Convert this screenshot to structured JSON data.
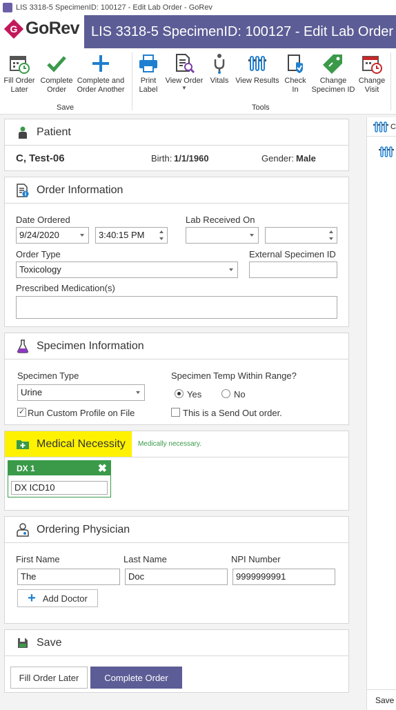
{
  "window": {
    "title": "LIS 3318-5 SpecimenID: 100127 - Edit Lab Order - GoRev"
  },
  "header": {
    "logo_text": "GoRev",
    "title": "LIS 3318-5 SpecimenID: 100127 - Edit Lab Order"
  },
  "ribbon": {
    "save_group": "Save",
    "tools_group": "Tools",
    "fill_order_later": "Fill Order\nLater",
    "complete_order": "Complete\nOrder",
    "complete_another": "Complete and\nOrder Another",
    "print_label": "Print\nLabel",
    "view_order": "View Order",
    "vitals": "Vitals",
    "view_results": "View Results",
    "check_in": "Check\nIn",
    "change_specimen_id": "Change\nSpecimen ID",
    "change_visit": "Change\nVisit"
  },
  "patient": {
    "heading": "Patient",
    "name": "C, Test-06",
    "birth_label": "Birth:",
    "birth": "1/1/1960",
    "gender_label": "Gender:",
    "gender": "Male"
  },
  "order_info": {
    "heading": "Order Information",
    "date_ordered_label": "Date Ordered",
    "date_ordered": "9/24/2020",
    "time_ordered": "3:40:15 PM",
    "lab_received_label": "Lab Received On",
    "order_type_label": "Order Type",
    "order_type": "Toxicology",
    "external_specimen_label": "External Specimen ID",
    "prescribed_med_label": "Prescribed Medication(s)"
  },
  "specimen": {
    "heading": "Specimen Information",
    "type_label": "Specimen Type",
    "type": "Urine",
    "temp_label": "Specimen Temp Within Range?",
    "yes": "Yes",
    "no": "No",
    "run_custom_profile": "Run Custom Profile on File",
    "send_out": "This is a Send Out order."
  },
  "medical_necessity": {
    "heading": "Medical Necessity",
    "status": "Medically necessary.",
    "dx_title": "DX 1",
    "dx_value": "DX ICD10"
  },
  "physician": {
    "heading": "Ordering Physician",
    "first_name_label": "First Name",
    "first_name": "The",
    "last_name_label": "Last Name",
    "last_name": "Doc",
    "npi_label": "NPI Number",
    "npi": "9999999991",
    "add_doctor": "Add Doctor"
  },
  "save_section": {
    "heading": "Save",
    "fill_order_later": "Fill Order Later",
    "complete_order": "Complete Order"
  },
  "right_pane": {
    "tab_label": "C",
    "save_label": "Save"
  },
  "colors": {
    "brand": "#5c5c96",
    "accent_green": "#3a9a4a",
    "highlight": "#fff200",
    "primary_button": "#5c5c96"
  }
}
